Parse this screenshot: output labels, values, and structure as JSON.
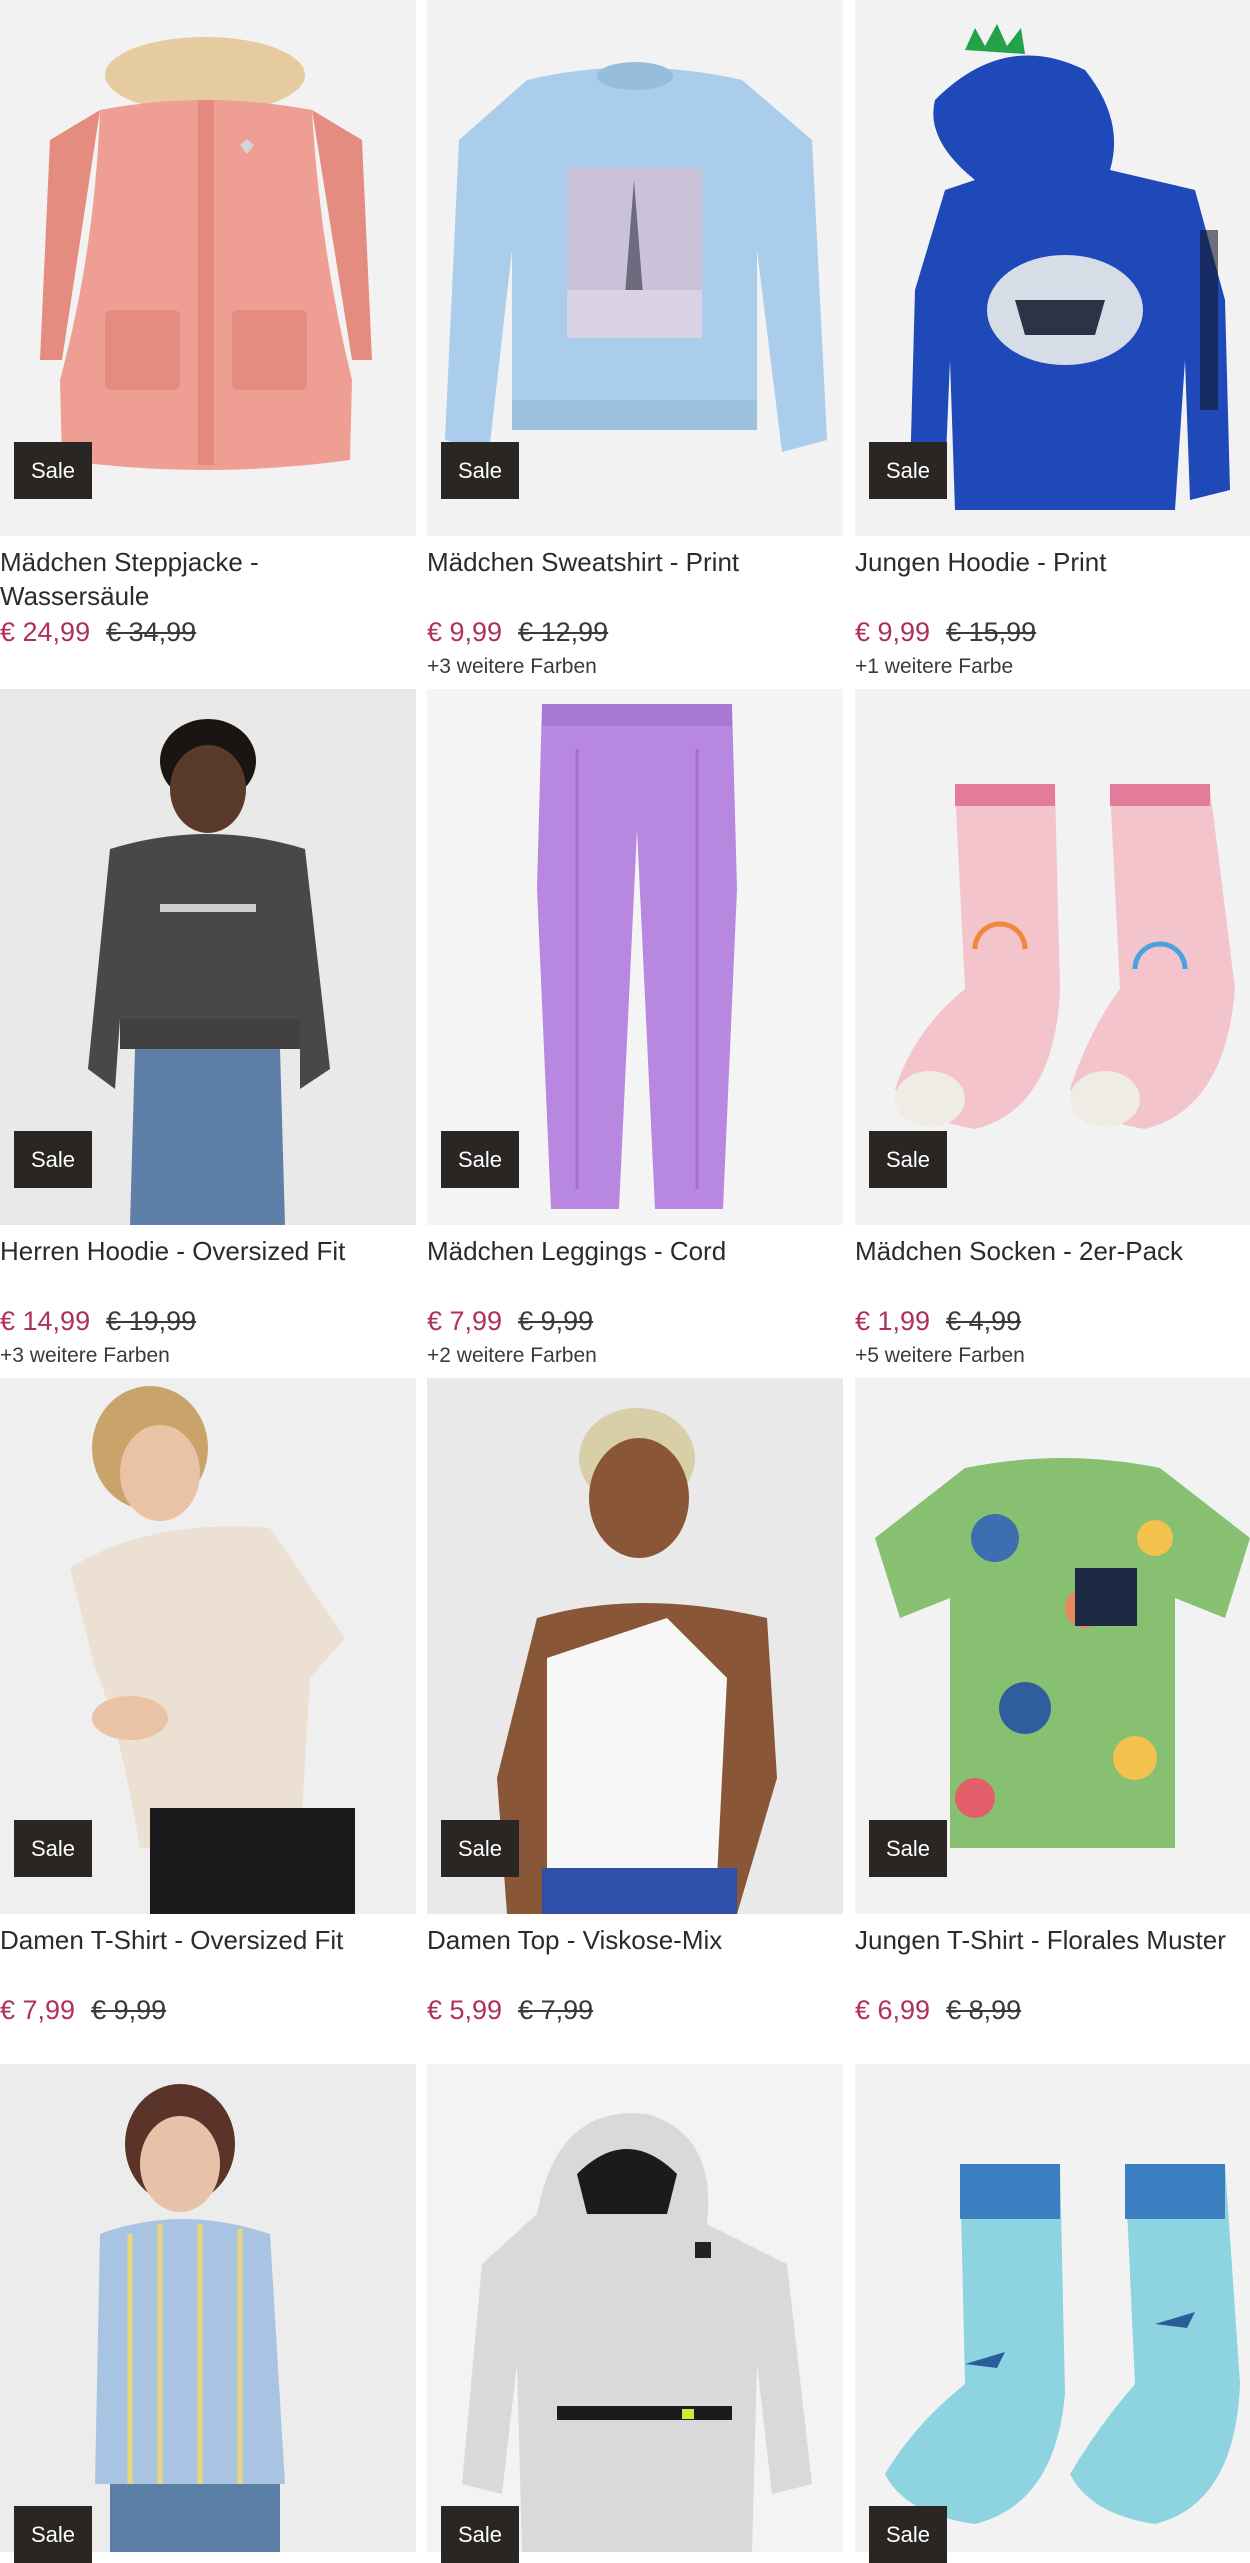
{
  "colors": {
    "price": "#b0305c",
    "sale_badge": "#2a2624",
    "image_bg": "#efefef"
  },
  "products": [
    {
      "title": "Mädchen Steppjacke - Wassersäule",
      "price": "€ 24,99",
      "old_price": "€ 34,99",
      "badge": "Sale",
      "more_colors": "",
      "image": "pink-puffer-jacket"
    },
    {
      "title": "Mädchen Sweatshirt - Print",
      "price": "€ 9,99",
      "old_price": "€ 12,99",
      "badge": "Sale",
      "more_colors": "+3 weitere Farben",
      "image": "light-blue-sweatshirt"
    },
    {
      "title": "Jungen Hoodie - Print",
      "price": "€ 9,99",
      "old_price": "€ 15,99",
      "badge": "Sale",
      "more_colors": "+1 weitere Farbe",
      "image": "blue-dino-hoodie"
    },
    {
      "title": "Herren Hoodie - Oversized Fit",
      "price": "€ 14,99",
      "old_price": "€ 19,99",
      "badge": "Sale",
      "more_colors": "+3 weitere Farben",
      "image": "man-grey-hoodie"
    },
    {
      "title": "Mädchen Leggings - Cord",
      "price": "€ 7,99",
      "old_price": "€ 9,99",
      "badge": "Sale",
      "more_colors": "+2 weitere Farben",
      "image": "purple-leggings"
    },
    {
      "title": "Mädchen Socken - 2er-Pack",
      "price": "€ 1,99",
      "old_price": "€ 4,99",
      "badge": "Sale",
      "more_colors": "+5 weitere Farben",
      "image": "pink-socks"
    },
    {
      "title": "Damen T-Shirt - Oversized Fit",
      "price": "€ 7,99",
      "old_price": "€ 9,99",
      "badge": "Sale",
      "more_colors": "",
      "image": "woman-beige-tshirt"
    },
    {
      "title": "Damen Top - Viskose-Mix",
      "price": "€ 5,99",
      "old_price": "€ 7,99",
      "badge": "Sale",
      "more_colors": "",
      "image": "woman-white-top"
    },
    {
      "title": "Jungen T-Shirt - Florales Muster",
      "price": "€ 6,99",
      "old_price": "€ 8,99",
      "badge": "Sale",
      "more_colors": "",
      "image": "floral-tshirt"
    },
    {
      "title": "",
      "price": "",
      "old_price": "",
      "badge": "Sale",
      "more_colors": "",
      "image": "woman-striped-shirt"
    },
    {
      "title": "",
      "price": "",
      "old_price": "",
      "badge": "Sale",
      "more_colors": "",
      "image": "grey-camo-hoodie"
    },
    {
      "title": "",
      "price": "",
      "old_price": "",
      "badge": "Sale",
      "more_colors": "",
      "image": "blue-shark-socks"
    }
  ]
}
